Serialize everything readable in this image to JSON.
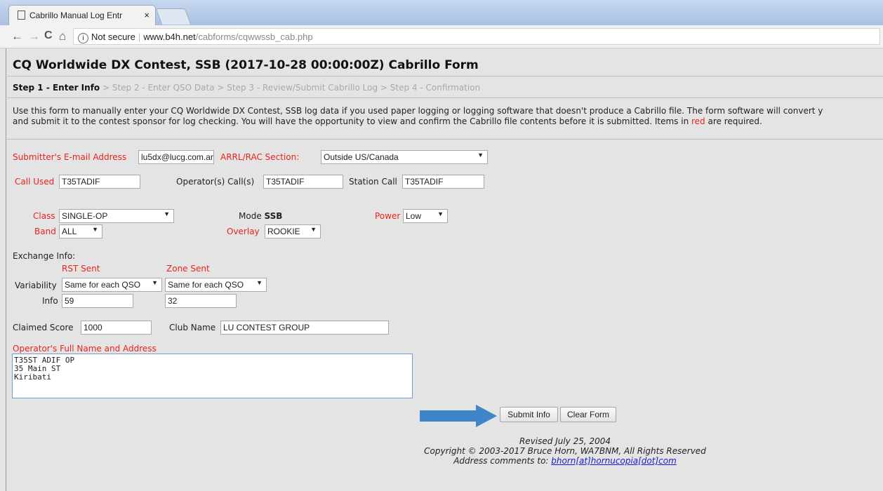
{
  "browser": {
    "tab_title": "Cabrillo Manual Log Entr",
    "tab_close": "×",
    "back": "←",
    "forward": "→",
    "reload": "C",
    "home": "⌂",
    "security": "Not secure",
    "url_host": "www.b4h.net",
    "url_path": "/cabforms/cqwwssb_cab.php"
  },
  "page": {
    "title": "CQ Worldwide DX Contest, SSB (2017-10-28 00:00:00Z) Cabrillo Form",
    "steps": {
      "current": "Step 1 - Enter Info",
      "rest": " > Step 2 - Enter QSO Data > Step 3 - Review/Submit Cabrillo Log > Step 4 - Confirmation"
    },
    "intro_line1": "Use this form to manually enter your CQ Worldwide DX Contest, SSB log data if you used paper logging or logging software that doesn't produce a Cabrillo file. The form software will convert y",
    "intro_line2a": "and submit it to the contest sponsor for log checking. You will have the opportunity to view and confirm the Cabrillo file contents before it is submitted. Items in ",
    "intro_red": "red",
    "intro_line2b": " are required."
  },
  "form": {
    "email_label": "Submitter's E-mail Address",
    "email_value": "lu5dx@lucg.com.ar",
    "section_label": "ARRL/RAC Section:",
    "section_value": "Outside US/Canada",
    "call_used_label": "Call Used",
    "call_used_value": "T35TADIF",
    "operators_label": "Operator(s) Call(s)",
    "operators_value": "T35TADIF",
    "station_call_label": "Station Call",
    "station_call_value": "T35TADIF",
    "class_label": "Class",
    "class_value": "SINGLE-OP",
    "mode_label": "Mode",
    "mode_value": "SSB",
    "power_label": "Power",
    "power_value": "Low",
    "band_label": "Band",
    "band_value": "ALL",
    "overlay_label": "Overlay",
    "overlay_value": "ROOKIE",
    "exchange_label": "Exchange Info:",
    "rst_sent_label": "RST Sent",
    "zone_sent_label": "Zone Sent",
    "variability_label": "Variability",
    "rst_variability": "Same for each QSO",
    "zone_variability": "Same for each QSO",
    "info_label": "Info",
    "rst_info": "59",
    "zone_info": "32",
    "claimed_score_label": "Claimed Score",
    "claimed_score_value": "1000",
    "club_name_label": "Club Name",
    "club_name_value": "LU CONTEST GROUP",
    "address_label": "Operator's Full Name and Address",
    "address_lines": [
      "T35ST ADIF OP",
      "35 Main ST",
      "Kiribati"
    ],
    "submit_label": "Submit Info",
    "clear_label": "Clear Form"
  },
  "footer": {
    "revised": "Revised July 25, 2004",
    "copyright": "Copyright © 2003-2017 Bruce Horn, WA7BNM, All Rights Reserved",
    "comments_prefix": "Address comments to: ",
    "comments_link": "bhorn[at]hornucopia[dot]com"
  },
  "colors": {
    "required": "#e8231d",
    "arrow": "#3f86c9",
    "page_bg": "#e4e4e4"
  }
}
